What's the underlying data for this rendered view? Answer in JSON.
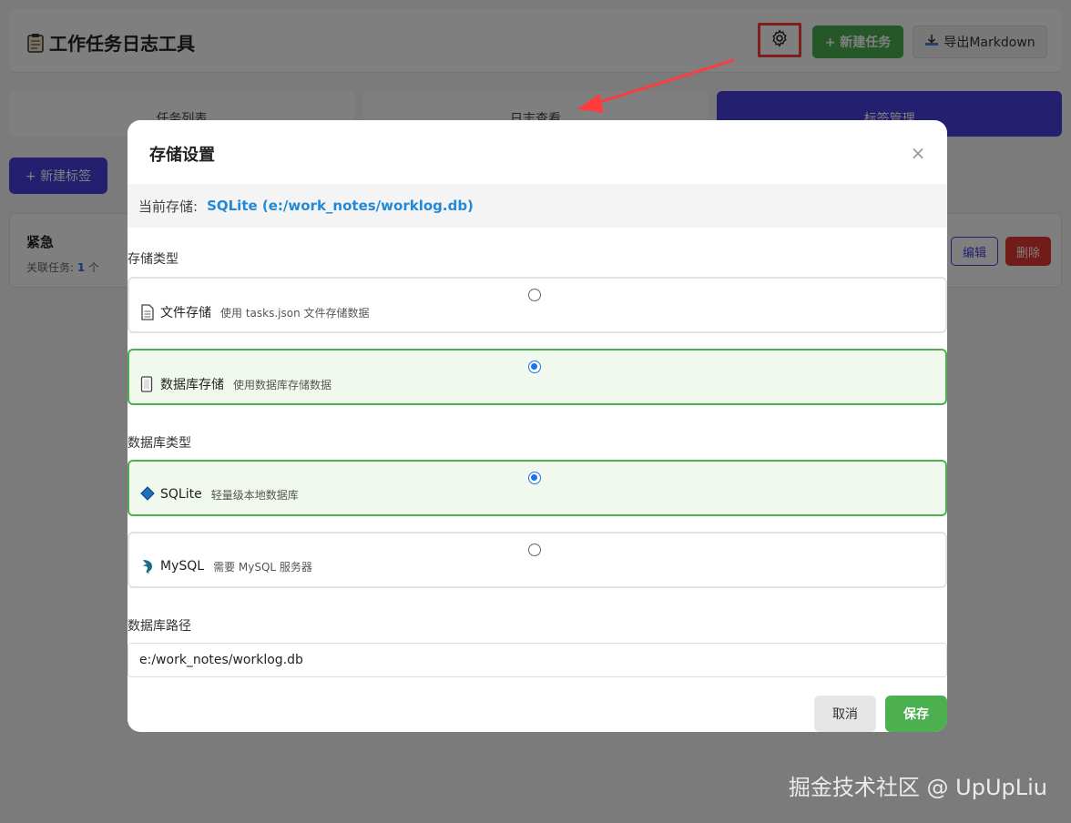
{
  "app": {
    "title": "工作任务日志工具",
    "new_task_label": "+ 新建任务",
    "export_label": "导出Markdown",
    "tabs": [
      {
        "label": "任务列表",
        "active": false
      },
      {
        "label": "日志查看",
        "active": false
      },
      {
        "label": "标签管理",
        "active": true
      }
    ],
    "new_tag_label": "+ 新建标签",
    "tags": [
      {
        "name": "紧急",
        "meta_prefix": "关联任务: ",
        "count": "1",
        "meta_suffix": " 个",
        "edit_label": "编辑",
        "delete_label": "删除"
      }
    ]
  },
  "modal": {
    "title": "存储设置",
    "close_glyph": "×",
    "current_label": "当前存储:",
    "current_value": "SQLite (e:/work_notes/worklog.db)",
    "storage_type_label": "存储类型",
    "storage_options": [
      {
        "name": "文件存储",
        "desc": "使用 tasks.json 文件存储数据",
        "icon": "document-icon",
        "selected": false
      },
      {
        "name": "数据库存储",
        "desc": "使用数据库存储数据",
        "icon": "database-icon",
        "selected": true
      }
    ],
    "db_type_label": "数据库类型",
    "db_options": [
      {
        "name": "SQLite",
        "desc": "轻量级本地数据库",
        "icon": "sqlite-diamond-icon",
        "selected": true
      },
      {
        "name": "MySQL",
        "desc": "需要 MySQL 服务器",
        "icon": "mysql-dolphin-icon",
        "selected": false
      }
    ],
    "db_path_label": "数据库路径",
    "db_path_value": "e:/work_notes/worklog.db",
    "cancel_label": "取消",
    "save_label": "保存"
  },
  "watermark": "掘金技术社区 @ UpUpLiu",
  "colors": {
    "primary": "#4a3fe0",
    "success": "#4caf50",
    "danger": "#e53935",
    "link": "#2389d6",
    "highlight": "#ff3b3b"
  }
}
